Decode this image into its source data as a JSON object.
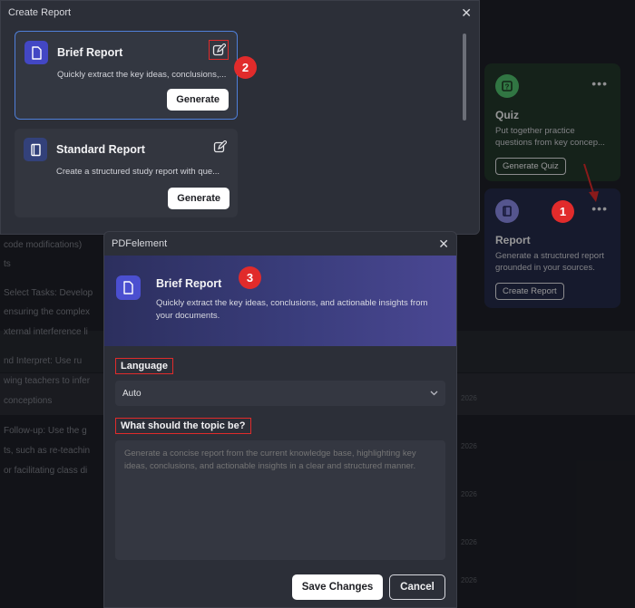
{
  "background": {
    "text_lines": [
      "code modifications)",
      "ts",
      "Select Tasks: Develop",
      "ensuring the complex",
      "xternal interference li",
      "nd Interpret: Use ru",
      "wing teachers to infer",
      "conceptions",
      "Follow-up: Use the g",
      "ts, such as re-teachin",
      "or facilitating class di"
    ],
    "dates": [
      "2026",
      "2026",
      "2026",
      "2026",
      "2026",
      "2026"
    ],
    "quiz_card": {
      "title": "Quiz",
      "desc_line1": "Put together practice",
      "desc_line2": "questions from key concep...",
      "button": "Generate Quiz",
      "menu": "•••"
    },
    "report_card": {
      "title": "Report",
      "desc_line1": "Generate a structured report",
      "desc_line2": "grounded in your sources.",
      "button": "Create Report",
      "menu": "•••"
    }
  },
  "create_report_dialog": {
    "title": "Create Report",
    "close": "✕",
    "cards": [
      {
        "title": "Brief Report",
        "desc": "Quickly extract the key ideas, conclusions,...",
        "button": "Generate"
      },
      {
        "title": "Standard Report",
        "desc": "Create a structured study report with que...",
        "button": "Generate"
      }
    ]
  },
  "pdfelement_dialog": {
    "title": "PDFelement",
    "close": "✕",
    "hero_title": "Brief Report",
    "hero_desc": "Quickly extract the key ideas, conclusions, and actionable insights from your documents.",
    "language_label": "Language",
    "language_value": "Auto",
    "topic_label": "What should the topic be?",
    "topic_placeholder": "Generate a concise report from the current knowledge base, highlighting key ideas, conclusions, and actionable insights in a clear and structured manner.",
    "save_button": "Save Changes",
    "cancel_button": "Cancel"
  },
  "markers": [
    "1",
    "2",
    "3"
  ],
  "colors": {
    "marker": "#e12b2b",
    "accent_blue": "#4f7fd9",
    "icon_indigo": "#4347c4"
  }
}
